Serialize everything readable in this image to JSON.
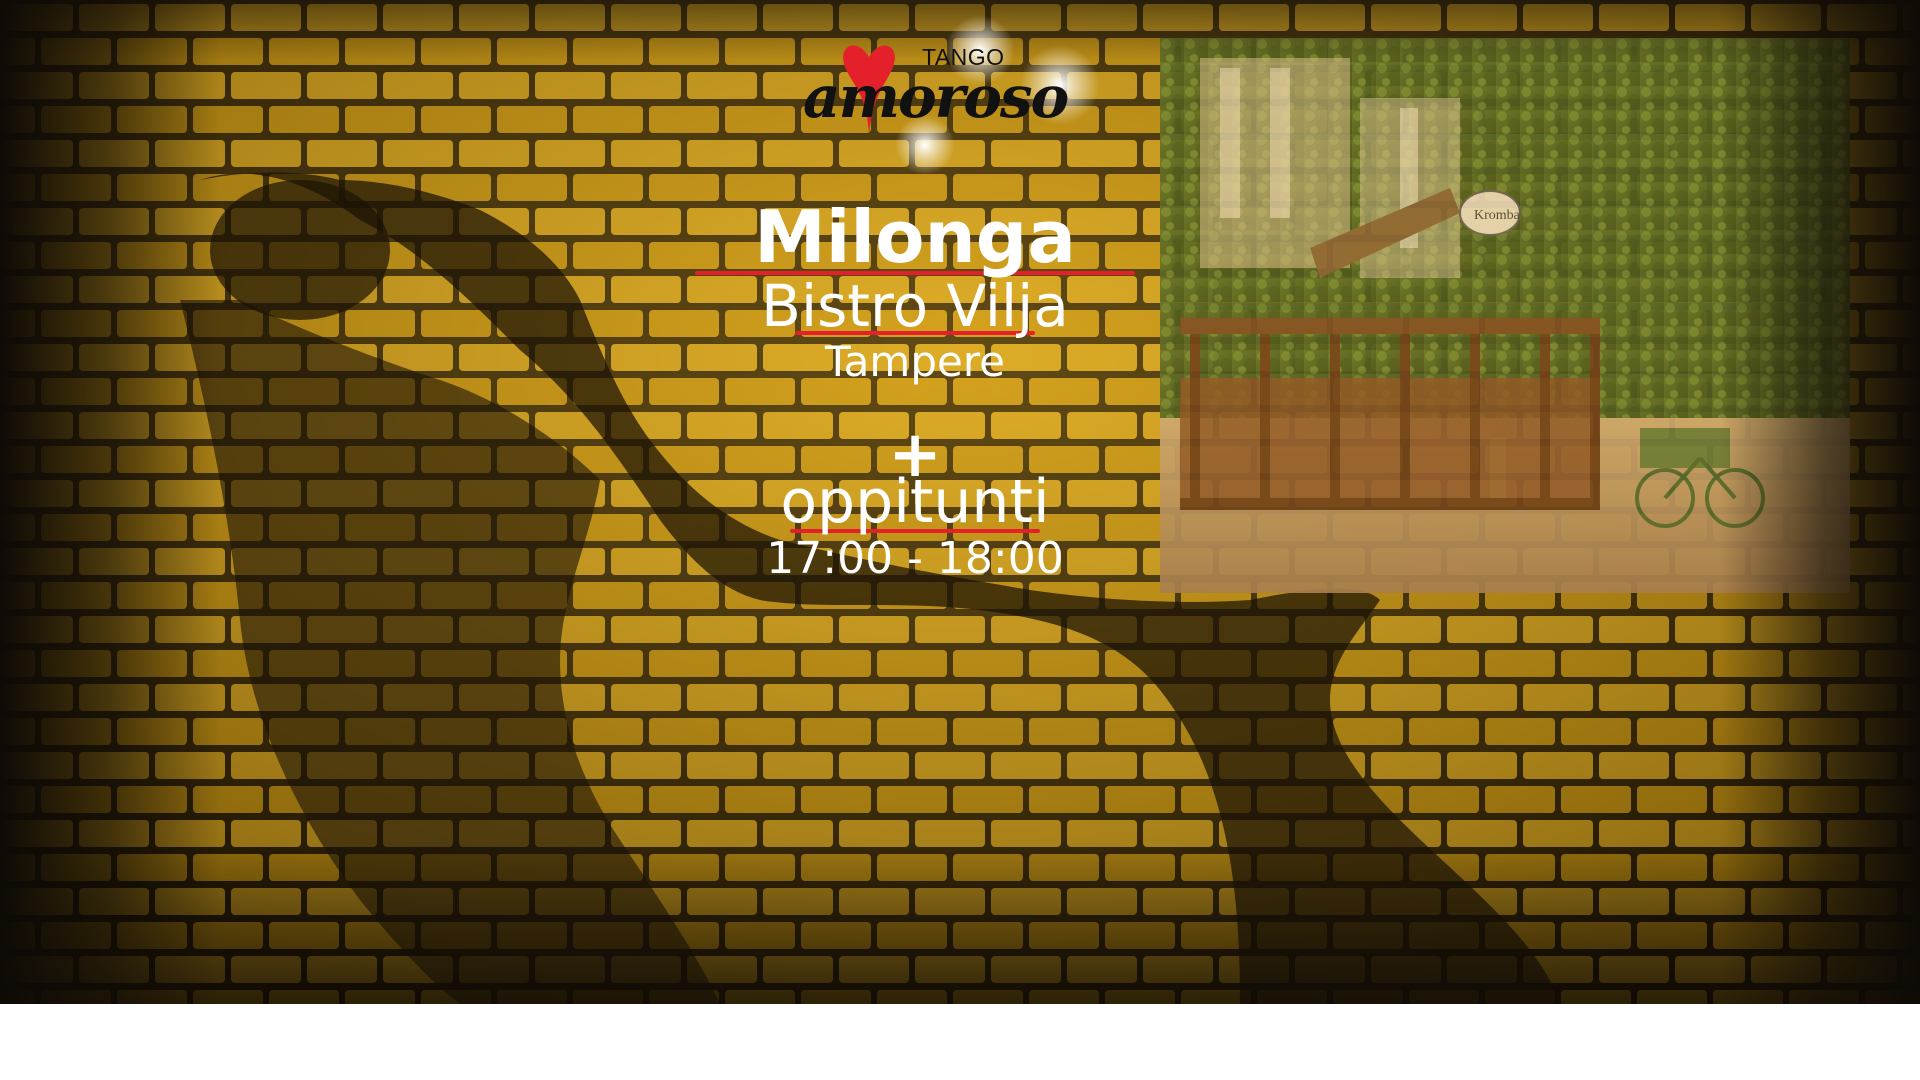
{
  "logo": {
    "top_word": "TANGO",
    "script_word": "amoroso",
    "heart_color": "#e4202a"
  },
  "event": {
    "title": "Milonga",
    "venue": "Bistro Vilja",
    "city": "Tampere",
    "plus": "+",
    "lesson": "oppitunti",
    "time": "17:00 - 18:00"
  },
  "photo": {
    "sign_text": "Kromba"
  },
  "colors": {
    "accent_red": "#e4202a",
    "brick_yellow": "#d7a51c",
    "text": "#ffffff"
  }
}
